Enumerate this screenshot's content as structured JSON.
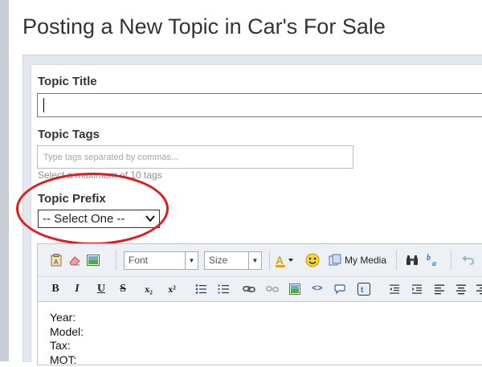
{
  "page": {
    "title": "Posting a New Topic in Car's For Sale"
  },
  "form": {
    "topic_title": {
      "label": "Topic Title",
      "value": ""
    },
    "topic_tags": {
      "label": "Topic Tags",
      "placeholder": "Type tags separated by commas...",
      "hint": "Select a maximum of 10 tags"
    },
    "topic_prefix": {
      "label": "Topic Prefix",
      "selected": "-- Select One --"
    }
  },
  "editor": {
    "toolbar": {
      "font_label": "Font",
      "size_label": "Size",
      "my_media_label": "My Media",
      "bold": "B",
      "italic": "I",
      "underline": "U",
      "strike": "S",
      "subscript": "x₂",
      "superscript": "x²"
    },
    "body_lines": [
      "Year:",
      "Model:",
      "Tax:",
      "MOT:"
    ]
  },
  "colors": {
    "annotation_circle": "#e11b1b",
    "panel_bg": "#e4e7ee"
  }
}
